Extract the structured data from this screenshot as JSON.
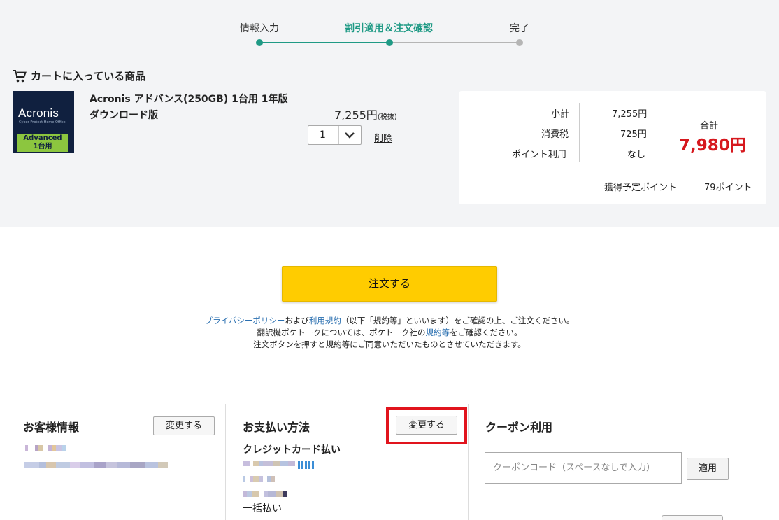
{
  "stepper": {
    "steps": [
      "情報入力",
      "割引適用＆注文確認",
      "完了"
    ],
    "active_index": 1,
    "colors": {
      "active": "#1f9a85",
      "inactive": "#b5b5b5"
    }
  },
  "cart": {
    "title": "カートに入っている商品",
    "item": {
      "image_brand": "Acronis",
      "image_subtitle": "Cyber Protect Home Office",
      "image_badge_line1": "Advanced",
      "image_badge_line2": "1台用",
      "name_line1": "Acronis アドバンス(250GB) 1台用 1年版",
      "name_line2": "ダウンロード版",
      "price": "7,255円",
      "price_tax_note": "(税抜)",
      "quantity": "1",
      "delete_label": "削除"
    }
  },
  "summary": {
    "subtotal_label": "小計",
    "subtotal_value": "7,255円",
    "tax_label": "消費税",
    "tax_value": "725円",
    "points_use_label": "ポイント利用",
    "points_use_value": "なし",
    "total_label": "合計",
    "total_value": "7,980円",
    "earn_points_label": "獲得予定ポイント",
    "earn_points_value": "79ポイント"
  },
  "order": {
    "button_label": "注文する",
    "notice": {
      "privacy_link": "プライバシーポリシー",
      "and": "および",
      "terms_link": "利用規約",
      "line1_rest": "（以下「規約等」といいます）をご確認の上、ご注文ください。",
      "line2_pre": "翻訳機ポケトークについては、ポケトーク社の",
      "line2_link": "規約等",
      "line2_post": "をご確認ください。",
      "line3": "注文ボタンを押すと規約等にご同意いただいたものとさせていただきます。"
    }
  },
  "customer": {
    "title": "お客様情報",
    "change_label": "変更する"
  },
  "payment": {
    "title": "お支払い方法",
    "change_label": "変更する",
    "method": "クレジットカード払い",
    "installment": "一括払い"
  },
  "coupon": {
    "title": "クーポン利用",
    "placeholder": "クーポンコード（スペースなしで入力）",
    "apply_label": "適用"
  }
}
